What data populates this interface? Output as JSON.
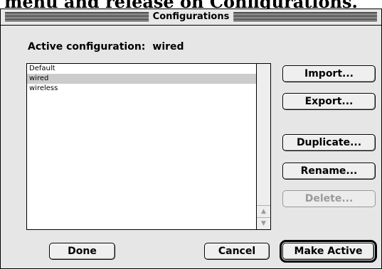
{
  "caption": {
    "text": "menu and release on Configurations."
  },
  "dialog": {
    "title": "Configurations",
    "active_label": "Active configuration:",
    "active_value": "wired"
  },
  "config_list": {
    "items": [
      {
        "label": "Default",
        "selected": false
      },
      {
        "label": "wired",
        "selected": true
      },
      {
        "label": "wireless",
        "selected": false
      }
    ]
  },
  "side_buttons": {
    "import": {
      "label": "Import...",
      "enabled": true
    },
    "export": {
      "label": "Export...",
      "enabled": true
    },
    "duplicate": {
      "label": "Duplicate...",
      "enabled": true
    },
    "rename": {
      "label": "Rename...",
      "enabled": true
    },
    "delete": {
      "label": "Delete...",
      "enabled": false
    }
  },
  "bottom_buttons": {
    "done": {
      "label": "Done"
    },
    "cancel": {
      "label": "Cancel"
    },
    "make_active": {
      "label": "Make Active",
      "default": true
    }
  },
  "icons": {
    "scroll_up": "scroll-up-arrow-icon",
    "scroll_down": "scroll-down-arrow-icon"
  },
  "colors": {
    "selection": "#cccccc",
    "dialog_bg": "#e6e6e6",
    "disabled_text": "#9a9a9a"
  }
}
